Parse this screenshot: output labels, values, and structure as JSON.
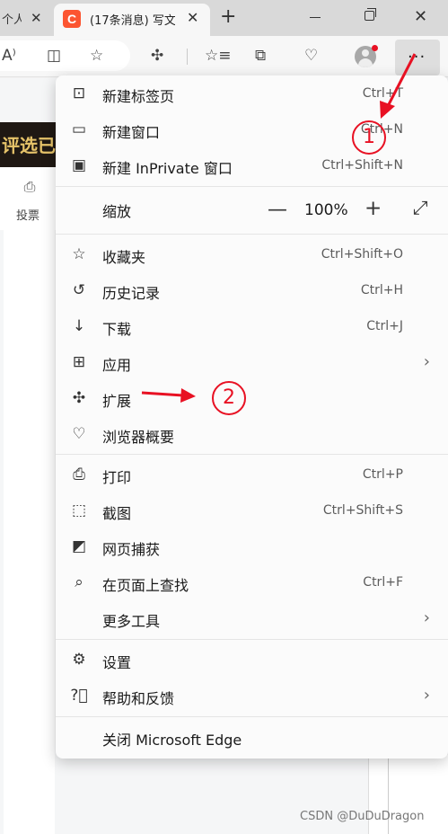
{
  "tabs": {
    "prev_title": "个人",
    "active_title": "(17条消息) 写文",
    "favicon_letter": "C",
    "favicon_color": "#fc5531"
  },
  "toolbar": {
    "read_aloud_icon": "read-aloud-icon",
    "split_icon": "split-screen-icon",
    "favorite_icon": "star-icon",
    "extensions_icon": "puzzle-icon",
    "favorites_icon": "favorites-list-icon",
    "collections_icon": "collections-icon",
    "health_icon": "browser-essentials-icon",
    "more_label": "···"
  },
  "page": {
    "banner_text": "评选已",
    "vote_label": "投票"
  },
  "menu": {
    "items": [
      {
        "label": "新建标签页",
        "shortcut": "Ctrl+T",
        "icon": "new-tab-icon"
      },
      {
        "label": "新建窗口",
        "shortcut": "Ctrl+N",
        "icon": "new-window-icon"
      },
      {
        "label": "新建 InPrivate 窗口",
        "shortcut": "Ctrl+Shift+N",
        "icon": "inprivate-icon"
      },
      {
        "label": "缩放",
        "icon": ""
      },
      {
        "label": "收藏夹",
        "shortcut": "Ctrl+Shift+O",
        "icon": "favorites-icon"
      },
      {
        "label": "历史记录",
        "shortcut": "Ctrl+H",
        "icon": "history-icon"
      },
      {
        "label": "下载",
        "shortcut": "Ctrl+J",
        "icon": "download-icon"
      },
      {
        "label": "应用",
        "icon": "apps-icon"
      },
      {
        "label": "扩展",
        "icon": "extensions-icon"
      },
      {
        "label": "浏览器概要",
        "icon": "browser-essentials-icon"
      },
      {
        "label": "打印",
        "shortcut": "Ctrl+P",
        "icon": "print-icon"
      },
      {
        "label": "截图",
        "shortcut": "Ctrl+Shift+S",
        "icon": "screenshot-icon"
      },
      {
        "label": "网页捕获",
        "icon": "web-capture-icon"
      },
      {
        "label": "在页面上查找",
        "shortcut": "Ctrl+F",
        "icon": "find-icon"
      },
      {
        "label": "更多工具",
        "icon": ""
      },
      {
        "label": "设置",
        "icon": "settings-icon"
      },
      {
        "label": "帮助和反馈",
        "icon": "help-icon"
      },
      {
        "label": "关闭 Microsoft Edge",
        "icon": ""
      }
    ],
    "zoom_value": "100%"
  },
  "annotations": {
    "marker1": "1",
    "marker2": "2",
    "color": "#e81123"
  },
  "watermark": "CSDN @DuDuDragon"
}
